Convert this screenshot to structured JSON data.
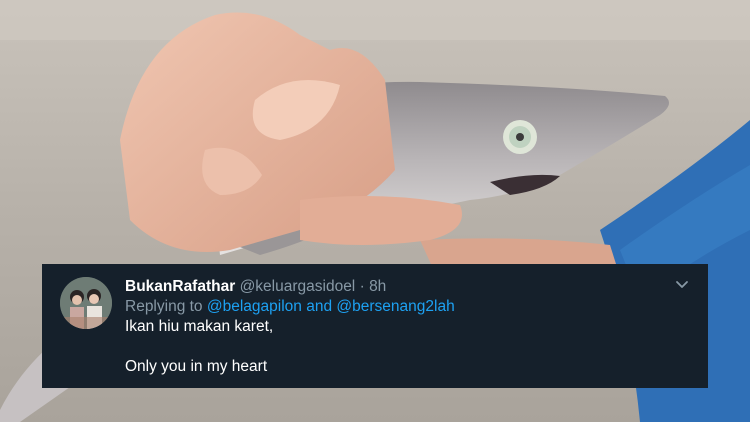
{
  "background": {
    "palette": {
      "sand": "#b9b3ac",
      "shark": "#c9c4c6",
      "skin": "#e7b8a1",
      "shirt": "#2f6fb6"
    }
  },
  "tweet": {
    "display_name": "BukanRafathar",
    "handle": "@keluargasidoel",
    "separator": "·",
    "time": "8h",
    "replying_prefix": "Replying to",
    "mention_1": "@belagapilon",
    "and_word": "and",
    "mention_2": "@bersenang2lah",
    "line1": "Ikan hiu makan karet,",
    "line2": "Only you in my heart",
    "icons": {
      "menu": "chevron-down-icon"
    },
    "colors": {
      "bg": "#15202b",
      "name": "#ffffff",
      "secondary": "#8899a6",
      "link": "#1da1f2"
    }
  }
}
